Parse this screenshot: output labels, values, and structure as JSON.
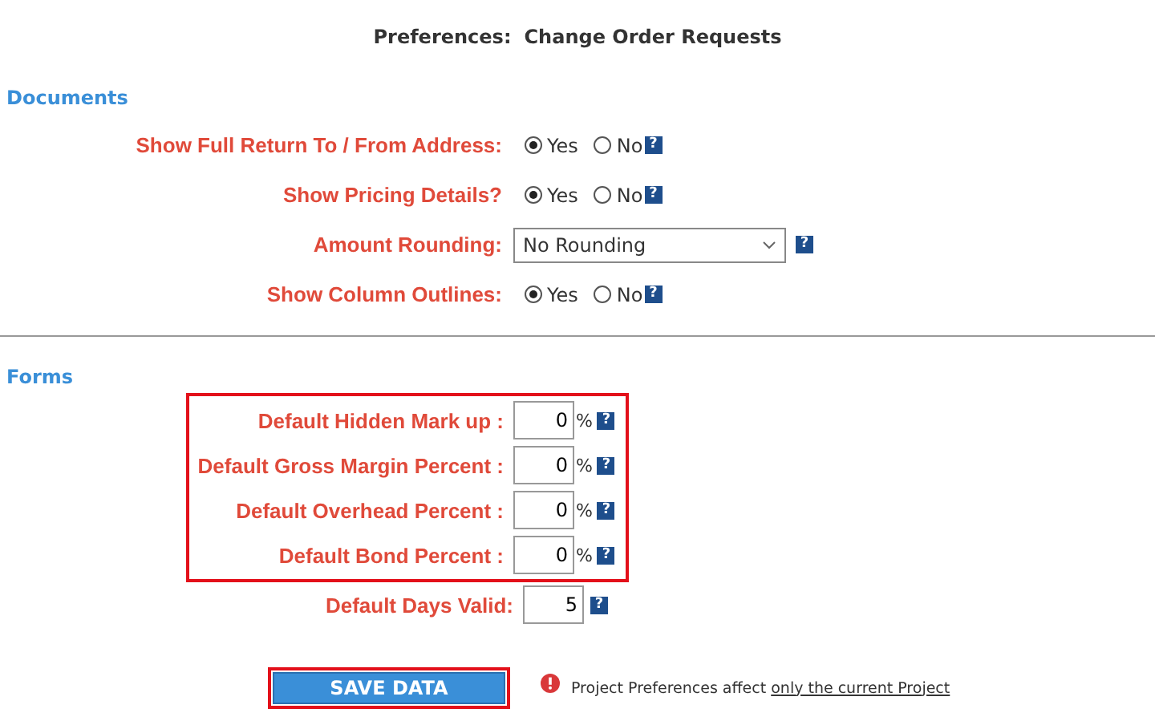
{
  "title": {
    "label": "Preferences:",
    "value": "Change Order Requests"
  },
  "documents": {
    "heading": "Documents",
    "rows": [
      {
        "kind": "radio",
        "label": "Show Full Return To / From Address:",
        "options": [
          {
            "label": "Yes",
            "selected": true
          },
          {
            "label": "No",
            "selected": false
          }
        ],
        "help": "?"
      },
      {
        "kind": "radio",
        "label": "Show Pricing Details?",
        "options": [
          {
            "label": "Yes",
            "selected": true
          },
          {
            "label": "No",
            "selected": false
          }
        ],
        "help": "?"
      },
      {
        "kind": "select",
        "label": "Amount Rounding:",
        "value": "No Rounding",
        "help": "?"
      },
      {
        "kind": "radio",
        "label": "Show Column Outlines:",
        "options": [
          {
            "label": "Yes",
            "selected": true
          },
          {
            "label": "No",
            "selected": false
          }
        ],
        "help": "?"
      }
    ]
  },
  "forms": {
    "heading": "Forms",
    "groups": [
      {
        "highlighted": true,
        "rows": [
          {
            "label": "Default Hidden Mark up :",
            "value": "0",
            "unit": "%",
            "help": "?"
          },
          {
            "label": "Default Gross Margin Percent :",
            "value": "0",
            "unit": "%",
            "help": "?"
          },
          {
            "label": "Default Overhead Percent :",
            "value": "0",
            "unit": "%",
            "help": "?"
          },
          {
            "label": "Default Bond Percent :",
            "value": "0",
            "unit": "%",
            "help": "?"
          }
        ]
      },
      {
        "highlighted": false,
        "rows": [
          {
            "label": "Default Days Valid:",
            "value": "5",
            "help": "?"
          }
        ]
      }
    ]
  },
  "save": {
    "label": "SAVE DATA",
    "highlighted": true
  },
  "notice": {
    "text": "Project Preferences affect",
    "link": "only the current Project"
  }
}
